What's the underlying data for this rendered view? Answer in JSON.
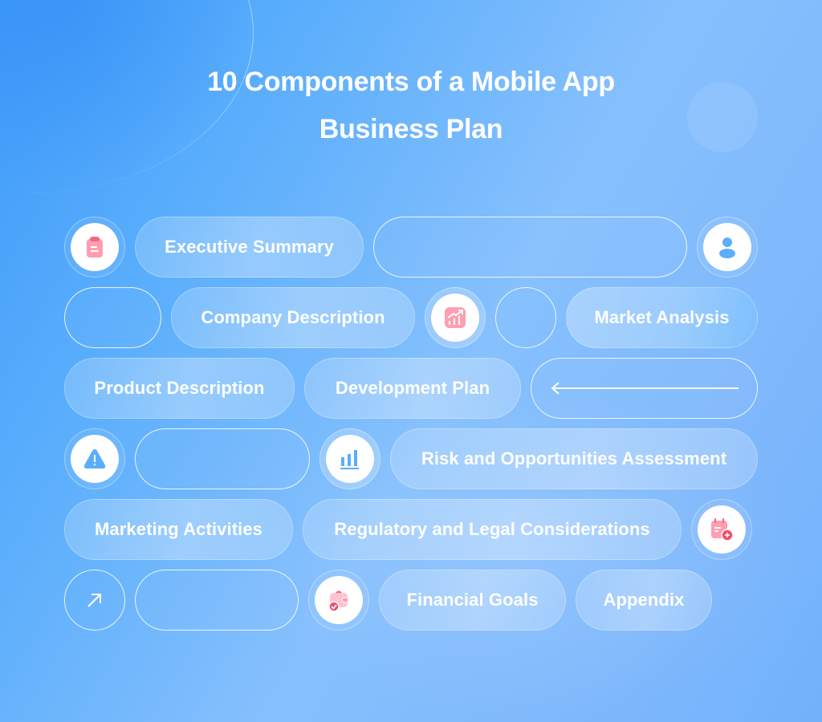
{
  "title": {
    "line1": "10 Components of a Mobile App",
    "line2": "Business Plan"
  },
  "components": [
    {
      "label": "Executive Summary"
    },
    {
      "label": "Company Description"
    },
    {
      "label": "Market Analysis"
    },
    {
      "label": "Product Description"
    },
    {
      "label": "Development Plan"
    },
    {
      "label": "Risk and Opportunities Assessment"
    },
    {
      "label": "Marketing Activities"
    },
    {
      "label": "Regulatory and Legal Considerations"
    },
    {
      "label": "Financial Goals"
    },
    {
      "label": "Appendix"
    }
  ],
  "icons": {
    "clipboard": "clipboard-icon",
    "user": "user-icon",
    "growth_chart": "growth-chart-icon",
    "warning": "warning-icon",
    "bar_chart": "bar-chart-icon",
    "calendar_add": "calendar-add-icon",
    "arrow_up_right": "arrow-up-right-icon",
    "wallet_check": "wallet-check-icon",
    "arrow_left": "arrow-left-icon"
  },
  "colors": {
    "accent_pink": "#ff9eb1",
    "accent_red": "#f0506e",
    "accent_blue": "#5aaefc",
    "text": "#ffffff"
  }
}
